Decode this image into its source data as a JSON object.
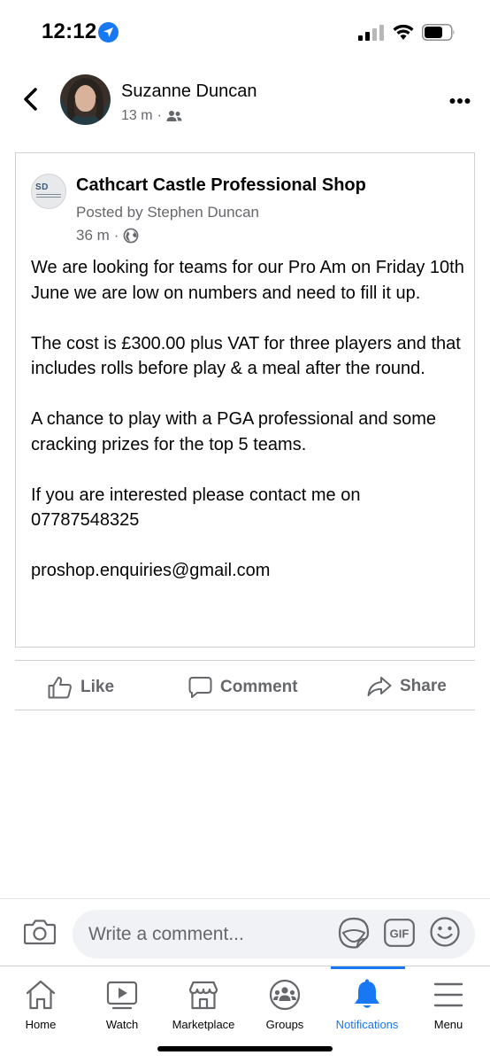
{
  "status_bar": {
    "time": "12:12"
  },
  "post": {
    "author": "Suzanne Duncan",
    "time": "13 m",
    "audience_icon": "friends-icon"
  },
  "shared_post": {
    "page_name": "Cathcart Castle Professional Shop",
    "logo_text": "SD",
    "posted_by": "Posted by Stephen Duncan",
    "time": "36 m",
    "audience_icon": "globe-icon",
    "paragraphs": [
      "We are looking for teams for our Pro Am on Friday 10th June we are low on numbers and need to fill it up.",
      "The cost is £300.00 plus VAT for three players and that includes rolls before play & a meal after the round.",
      "A chance to play with a PGA professional and some cracking prizes for the top 5 teams.",
      "If you are interested please contact me on 07787548325",
      "proshop.enquiries@gmail.com"
    ]
  },
  "actions": {
    "like": "Like",
    "comment": "Comment",
    "share": "Share"
  },
  "composer": {
    "placeholder": "Write a comment..."
  },
  "tabs": [
    {
      "label": "Home",
      "icon": "home-icon"
    },
    {
      "label": "Watch",
      "icon": "watch-icon"
    },
    {
      "label": "Marketplace",
      "icon": "marketplace-icon"
    },
    {
      "label": "Groups",
      "icon": "groups-icon"
    },
    {
      "label": "Notifications",
      "icon": "bell-icon",
      "active": true
    },
    {
      "label": "Menu",
      "icon": "menu-icon"
    }
  ],
  "colors": {
    "accent": "#1877f2",
    "secondary_text": "#65676b",
    "border": "#ced0d4"
  }
}
